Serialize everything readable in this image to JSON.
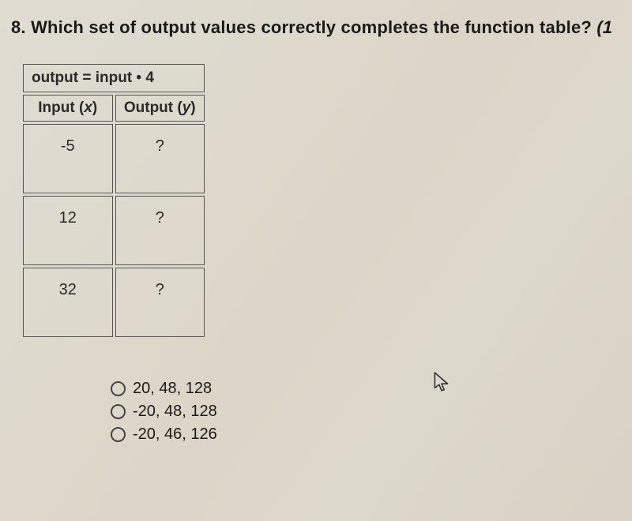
{
  "question": {
    "number": "8.",
    "text": "Which set of output values correctly completes the function table?",
    "points_prefix": "(1"
  },
  "table": {
    "rule": "output = input • 4",
    "header_input": "Input (",
    "header_input_var": "x",
    "header_input_close": ")",
    "header_output": "Output (",
    "header_output_var": "y",
    "header_output_close": ")",
    "rows": [
      {
        "input": "-5",
        "output": "?"
      },
      {
        "input": "12",
        "output": "?"
      },
      {
        "input": "32",
        "output": "?"
      }
    ]
  },
  "options": [
    {
      "label": "20, 48, 128"
    },
    {
      "label": "-20, 48, 128"
    },
    {
      "label": "-20, 46, 126"
    }
  ]
}
